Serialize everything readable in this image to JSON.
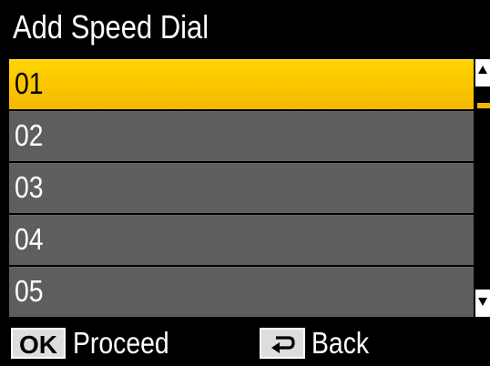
{
  "header": {
    "title": "Add Speed Dial"
  },
  "list": {
    "items": [
      {
        "label": "01",
        "selected": true
      },
      {
        "label": "02",
        "selected": false
      },
      {
        "label": "03",
        "selected": false
      },
      {
        "label": "04",
        "selected": false
      },
      {
        "label": "05",
        "selected": false
      }
    ]
  },
  "footer": {
    "ok_key": "OK",
    "ok_action": "Proceed",
    "back_icon": "back-arrow-icon",
    "back_action": "Back"
  },
  "colors": {
    "background": "#000000",
    "item": "#5e5e5e",
    "selected": "#ffc800",
    "scroll_thumb": "#f2b600"
  }
}
